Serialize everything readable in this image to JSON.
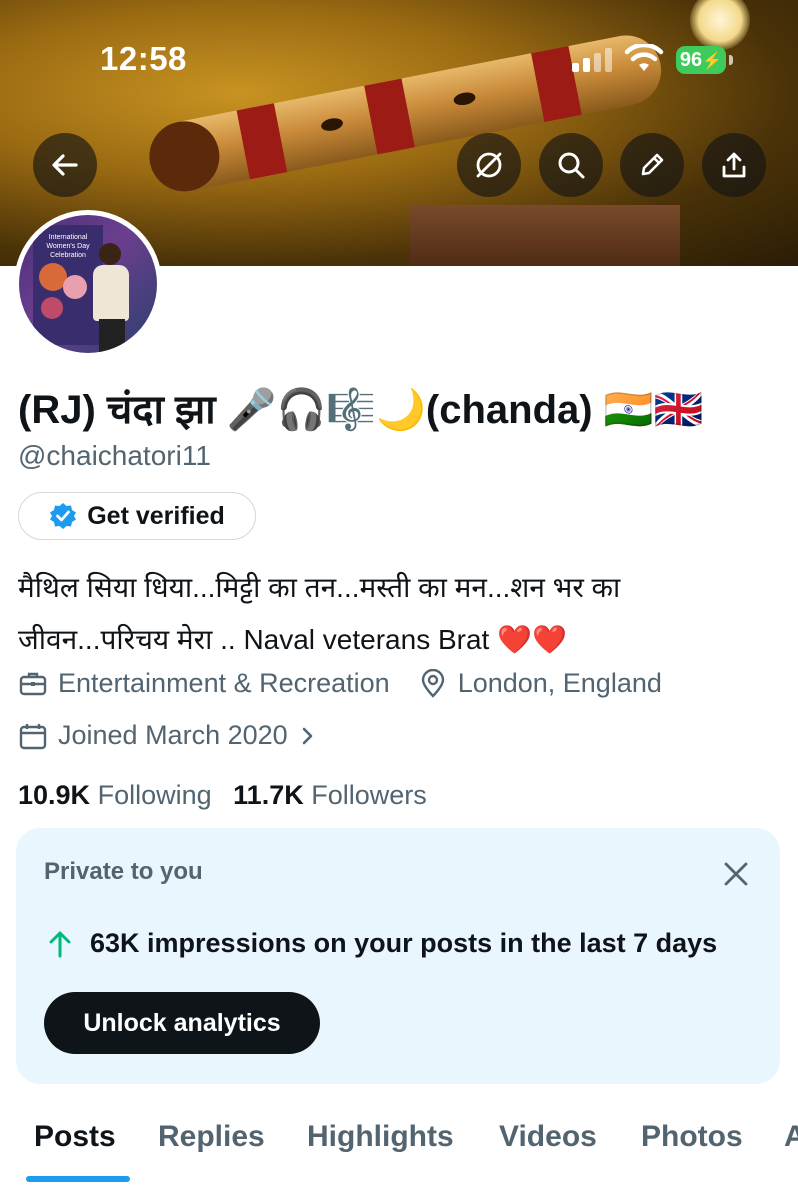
{
  "status_bar": {
    "time": "12:58",
    "battery": "96"
  },
  "colors": {
    "accent": "#1d9bf0",
    "positive": "#00ba7c",
    "text": "#0f1419",
    "muted": "#536471"
  },
  "profile": {
    "display_name": "(RJ) चंदा झा 🎤🎧🎼🌙(chanda) 🇮🇳🇬🇧",
    "handle": "@chaichatori11",
    "get_verified_label": "Get verified",
    "bio_line1": "मैथिल सिया धिया...मिट्टी का तन...मस्ती का मन...शन भर का",
    "bio_line2": "जीवन...परिचय मेरा .. Naval veterans Brat ❤️❤️",
    "category": "Entertainment & Recreation",
    "location": "London, England",
    "joined": "Joined March 2020",
    "following_count": "10.9K",
    "following_label": "Following",
    "followers_count": "11.7K",
    "followers_label": "Followers"
  },
  "analytics_card": {
    "private_label": "Private to you",
    "stat_text": "63K impressions on your posts in the last 7 days",
    "button_label": "Unlock analytics"
  },
  "tabs": [
    "Posts",
    "Replies",
    "Highlights",
    "Videos",
    "Photos",
    "A"
  ],
  "avatar_poster_text": "International Women's Day Celebration",
  "icons": [
    "back-arrow-icon",
    "grok-icon",
    "search-icon",
    "edit-pencil-icon",
    "share-icon",
    "verified-badge-icon",
    "briefcase-icon",
    "location-pin-icon",
    "calendar-icon",
    "chevron-right-icon",
    "close-icon",
    "arrow-up-icon"
  ]
}
